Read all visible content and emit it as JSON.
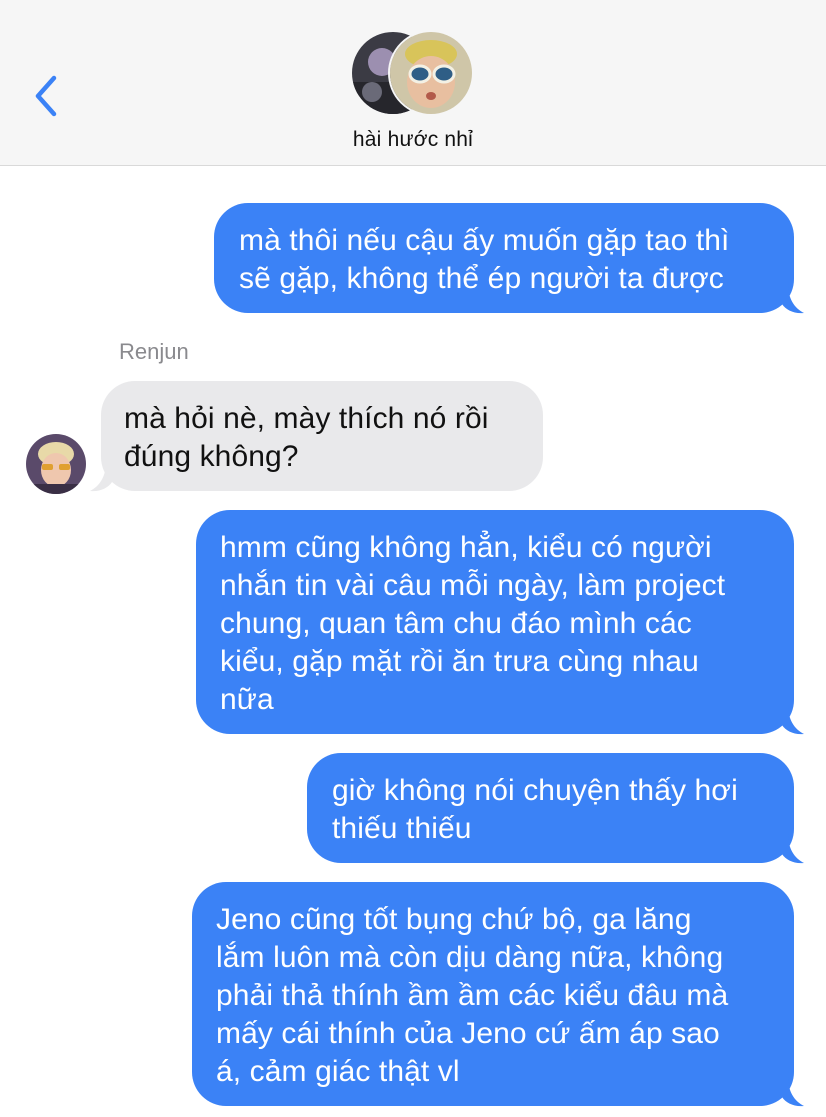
{
  "header": {
    "title": "hài hước nhỉ",
    "back_icon": "chevron-left-icon",
    "accent": "#3b82f6"
  },
  "messages": [
    {
      "direction": "outgoing",
      "lines": [
        "mà thôi nếu cậu ấy muốn gặp tao thì",
        "sẽ gặp, không thể ép người ta được"
      ]
    },
    {
      "direction": "incoming",
      "sender": "Renjun",
      "lines": [
        "mà hỏi nè, mày thích nó rồi",
        "đúng không?"
      ]
    },
    {
      "direction": "outgoing",
      "lines": [
        "hmm cũng không hẳn, kiểu có người",
        "nhắn tin vài câu mỗi ngày, làm project",
        "chung, quan tâm chu đáo mình các",
        "kiểu, gặp mặt rồi ăn trưa cùng nhau",
        "nữa"
      ]
    },
    {
      "direction": "outgoing",
      "lines": [
        "giờ không nói chuyện thấy hơi",
        "thiếu thiếu"
      ]
    },
    {
      "direction": "outgoing",
      "lines": [
        "Jeno cũng tốt bụng chứ bộ, ga lăng",
        "lắm luôn mà còn dịu dàng nữa, không",
        "phải thả thính ầm ầm các kiểu đâu mà",
        "mấy cái thính của Jeno cứ ấm áp sao",
        "á, cảm giác thật vl"
      ]
    }
  ],
  "colors": {
    "outgoing_bubble": "#3b82f6",
    "incoming_bubble": "#e9e9eb",
    "header_bg": "#f6f6f6"
  }
}
